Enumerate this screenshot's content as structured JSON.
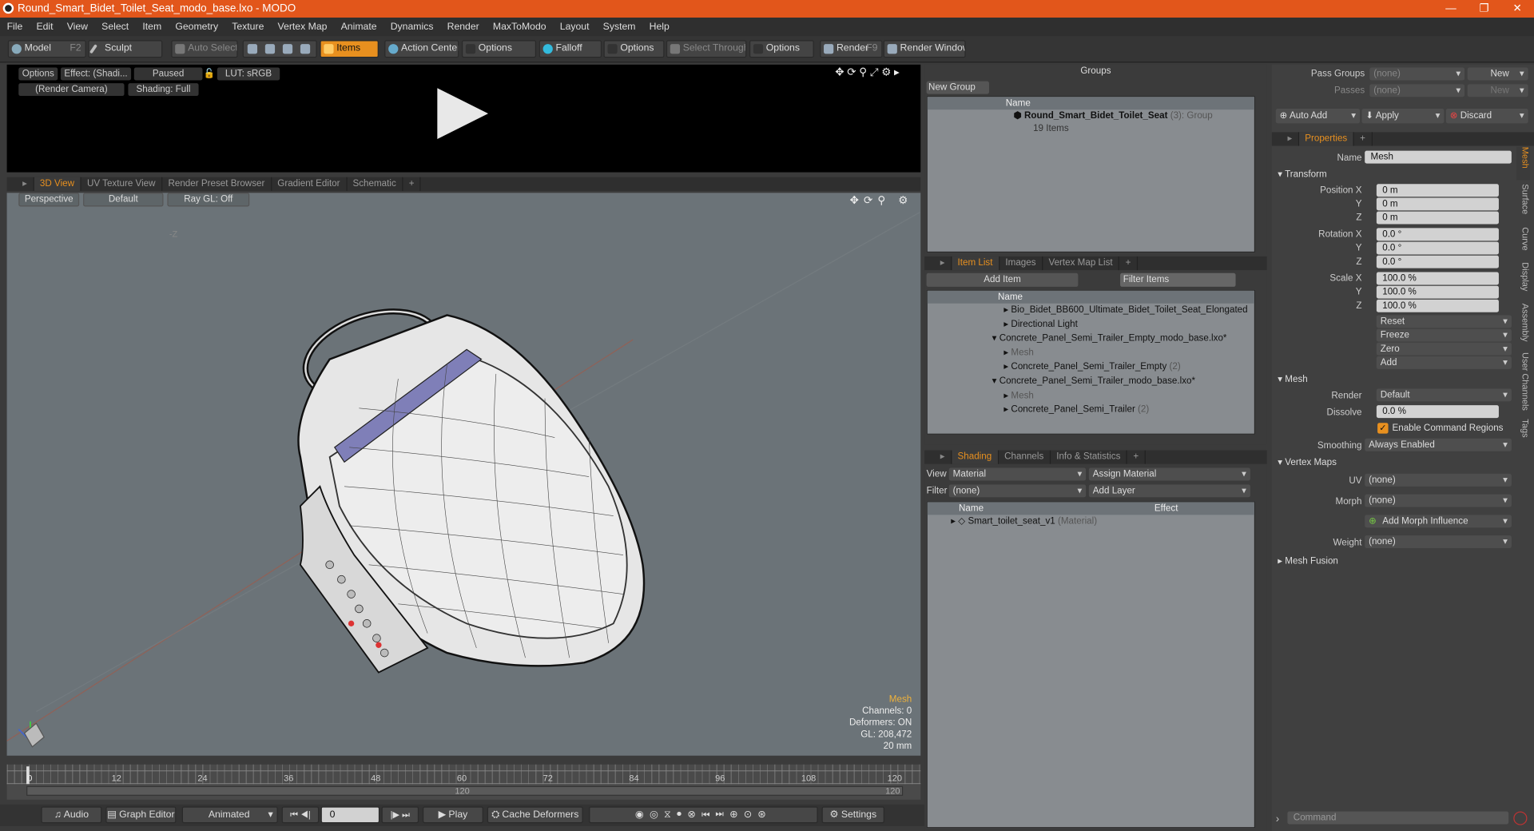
{
  "window": {
    "title": "Round_Smart_Bidet_Toilet_Seat_modo_base.lxo - MODO",
    "controls": [
      "—",
      "❐",
      "✕"
    ]
  },
  "menu": [
    "File",
    "Edit",
    "View",
    "Select",
    "Item",
    "Geometry",
    "Texture",
    "Vertex Map",
    "Animate",
    "Dynamics",
    "Render",
    "MaxToModo",
    "Layout",
    "System",
    "Help"
  ],
  "toolbar": {
    "model": "Model",
    "model_key": "F2",
    "sculpt": "Sculpt",
    "auto_select": "Auto Select",
    "items": "Items",
    "action_center": "Action Center",
    "options1": "Options",
    "falloff": "Falloff",
    "options2": "Options",
    "select_through": "Select Through",
    "options3": "Options",
    "render": "Render",
    "render_key": "F9",
    "render_window": "Render Window"
  },
  "preview": {
    "options": "Options",
    "effect": "Effect: (Shadi...",
    "paused": "Paused",
    "lut": "LUT: sRGB",
    "camera": "(Render Camera)",
    "shading": "Shading: Full"
  },
  "view_tabs": [
    "3D View",
    "UV Texture View",
    "Render Preset Browser",
    "Gradient Editor",
    "Schematic",
    "+"
  ],
  "viewport": {
    "perspective": "Perspective",
    "default": "Default",
    "raygl": "Ray GL: Off",
    "axis_marker": "-Z",
    "info": {
      "mesh": "Mesh",
      "channels": "Channels: 0",
      "deformers": "Deformers: ON",
      "gl": "GL: 208,472",
      "scale": "20 mm"
    }
  },
  "timeline": {
    "ticks": [
      "0",
      "12",
      "24",
      "36",
      "48",
      "60",
      "72",
      "84",
      "96",
      "108",
      "120"
    ],
    "end_top": "120",
    "end_bottom": "120",
    "mid": "120"
  },
  "bottom": {
    "audio": "Audio",
    "graph_editor": "Graph Editor",
    "animated": "Animated",
    "frame": "0",
    "play": "Play",
    "cache": "Cache Deformers",
    "settings": "Settings"
  },
  "groups": {
    "title": "Groups",
    "new_group": "New Group",
    "col_name": "Name",
    "item_name": "Round_Smart_Bidet_Toilet_Seat",
    "item_count": "(3)",
    "item_type": ": Group",
    "item_sub": "19 Items"
  },
  "itemlist": {
    "tabs": [
      "Item List",
      "Images",
      "Vertex Map List",
      "+"
    ],
    "add_item": "Add Item",
    "filter": "Filter Items",
    "col_name": "Name",
    "rows": [
      {
        "label": "Bio_Bidet_BB600_Ultimate_Bidet_Toilet_Seat_Elongated",
        "extra": "",
        "indent": 2,
        "dim": false
      },
      {
        "label": "Directional Light",
        "extra": "",
        "indent": 2,
        "dim": false
      },
      {
        "label": "Concrete_Panel_Semi_Trailer_Empty_modo_base.lxo*",
        "extra": "",
        "indent": 1,
        "dim": false
      },
      {
        "label": "Mesh",
        "extra": "",
        "indent": 2,
        "dim": true
      },
      {
        "label": "Concrete_Panel_Semi_Trailer_Empty",
        "extra": "(2)",
        "indent": 2,
        "dim": false
      },
      {
        "label": "Concrete_Panel_Semi_Trailer_modo_base.lxo*",
        "extra": "",
        "indent": 1,
        "dim": false
      },
      {
        "label": "Mesh",
        "extra": "",
        "indent": 2,
        "dim": true
      },
      {
        "label": "Concrete_Panel_Semi_Trailer",
        "extra": "(2)",
        "indent": 2,
        "dim": false
      }
    ]
  },
  "shading": {
    "tabs": [
      "Shading",
      "Channels",
      "Info & Statistics",
      "+"
    ],
    "view_label": "View",
    "view_val": "Material",
    "assign": "Assign Material",
    "filter_label": "Filter",
    "filter_val": "(none)",
    "add_layer": "Add Layer",
    "col_name": "Name",
    "col_effect": "Effect",
    "row": "Smart_toilet_seat_v1",
    "row_type": "(Material)"
  },
  "props": {
    "pass_groups": "Pass Groups",
    "passes": "Passes",
    "none": "(none)",
    "new": "New",
    "auto_add": "Auto Add",
    "apply": "Apply",
    "discard": "Discard",
    "tab": "Properties",
    "name_label": "Name",
    "name_val": "Mesh",
    "transform": "Transform",
    "pos_label": "Position X",
    "y": "Y",
    "z": "Z",
    "pos": [
      "0 m",
      "0 m",
      "0 m"
    ],
    "rot_label": "Rotation X",
    "rot": [
      "0.0 °",
      "0.0 °",
      "0.0 °"
    ],
    "scale_label": "Scale X",
    "scale": [
      "100.0 %",
      "100.0 %",
      "100.0 %"
    ],
    "reset": "Reset",
    "freeze": "Freeze",
    "zero": "Zero",
    "add": "Add",
    "mesh": "Mesh",
    "render_label": "Render",
    "render_val": "Default",
    "dissolve_label": "Dissolve",
    "dissolve_val": "0.0 %",
    "ecr": "Enable Command Regions",
    "smoothing_label": "Smoothing",
    "smoothing_val": "Always Enabled",
    "vertex_maps": "Vertex Maps",
    "uv_label": "UV",
    "morph_label": "Morph",
    "add_morph": "Add Morph Influence",
    "weight_label": "Weight",
    "mesh_fusion": "Mesh Fusion",
    "command": "Command",
    "side_tabs": [
      "Mesh",
      "Surface",
      "Curve",
      "Display",
      "Assembly",
      "User Channels",
      "Tags"
    ]
  },
  "colors": {
    "accent": "#e8901f",
    "titlebar": "#e2561b"
  }
}
